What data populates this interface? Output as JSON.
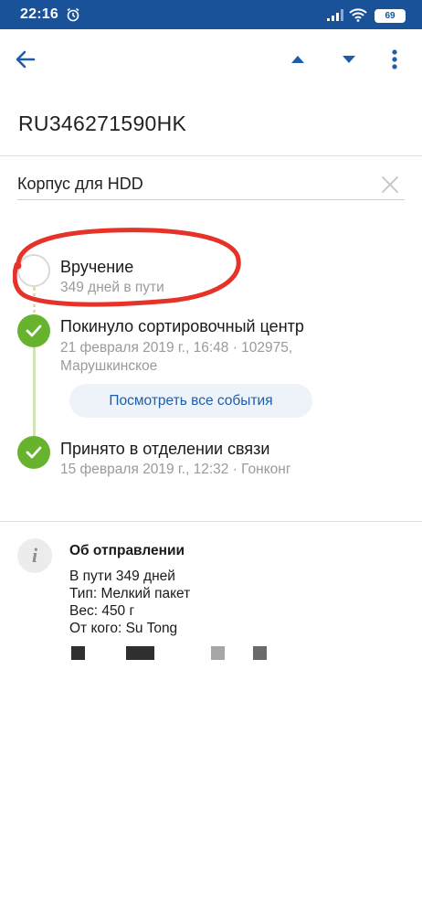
{
  "status_bar": {
    "time": "22:16",
    "battery": "69"
  },
  "app_bar": {
    "back_icon": "arrow-left-icon",
    "prev_icon": "triangle-up-icon",
    "next_icon": "triangle-down-icon",
    "menu_icon": "more-vertical-icon"
  },
  "parcel": {
    "tracking_number": "RU346271590HK",
    "name_value": "Корпус для HDD",
    "name_placeholder": "Корпус для HDD"
  },
  "timeline": {
    "steps": [
      {
        "title": "Вручение",
        "subtitle": "349 дней в пути",
        "state": "pending"
      },
      {
        "title": "Покинуло сортировочный центр",
        "subtitle": "21 февраля 2019 г., 16:48 · 102975, Марушкинское",
        "state": "done"
      },
      {
        "title": "Принято в отделении связи",
        "subtitle": "15 февраля 2019 г., 12:32 · Гонконг",
        "state": "done"
      }
    ],
    "all_events_label": "Посмотреть все события"
  },
  "shipment_info": {
    "title": "Об отправлении",
    "lines": [
      "В пути 349 дней",
      "Тип: Мелкий пакет",
      "Вес: 450 г",
      "От кого: Su Tong"
    ]
  },
  "colors": {
    "brand_blue": "#1a5299",
    "check_green": "#67b32e",
    "annotation_red": "#e5332a"
  }
}
